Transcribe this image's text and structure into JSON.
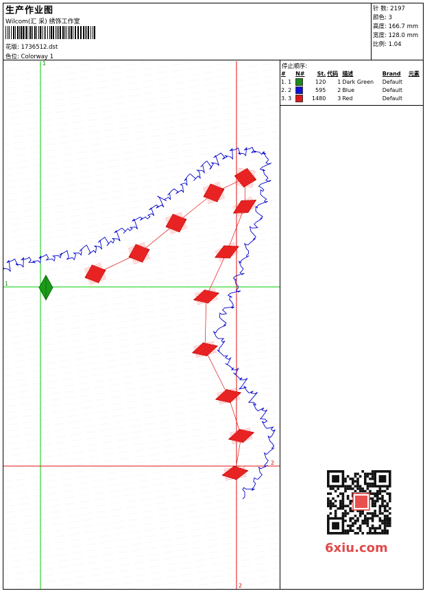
{
  "header": {
    "title": "生产作业图",
    "company": "Wilcom(汇 采) 绣饰工作室",
    "design_label": "花版:",
    "design_value": "1736512.dst",
    "colorway_label": "色位:",
    "colorway_value": "Colorway 1"
  },
  "stats": {
    "stitches_label": "针 数:",
    "stitches_value": "2197",
    "colors_label": "颜色:",
    "colors_value": "3",
    "height_label": "高度:",
    "height_value": "166.7 mm",
    "width_label": "宽度:",
    "width_value": "128.0 mm",
    "scale_label": "比例:",
    "scale_value": "1.04"
  },
  "stop_sequence": {
    "title": "停止顺序:",
    "columns": [
      "#",
      "N#",
      "St.",
      "代码",
      "描述",
      "Brand",
      "元素"
    ],
    "rows": [
      {
        "num": "1. 1",
        "stitches": "120",
        "code": "1",
        "desc": "Dark Green",
        "brand": "Default",
        "color": "#1a8a1a"
      },
      {
        "num": "2. 2",
        "stitches": "595",
        "code": "2",
        "desc": "Blue",
        "brand": "Default",
        "color": "#1010d8"
      },
      {
        "num": "3. 3",
        "stitches": "1480",
        "code": "3",
        "desc": "Red",
        "brand": "Default",
        "color": "#e01818"
      }
    ]
  },
  "guides": {
    "green_top": "1",
    "green_left": "1",
    "red_bottom": "2",
    "red_right": "2"
  },
  "watermark": "6xiu.com",
  "colors": {
    "green": "#00cc00",
    "red": "#dd1111",
    "blue": "#0000cc"
  }
}
